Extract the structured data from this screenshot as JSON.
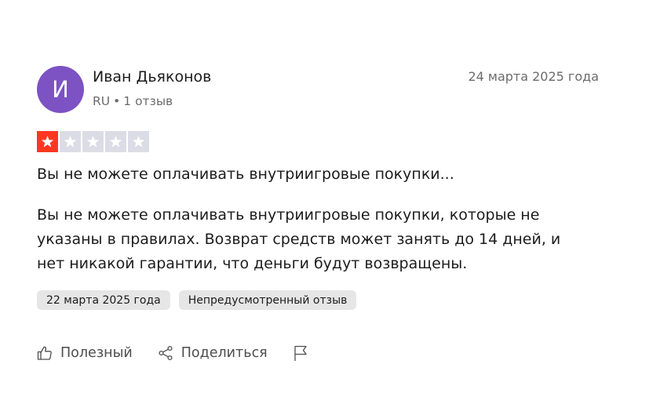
{
  "review": {
    "author": {
      "initial": "И",
      "name": "Иван Дьяконов",
      "country": "RU",
      "separator": "•",
      "review_count": "1 отзыв",
      "avatar_color": "#7d52c3"
    },
    "date": "24 марта 2025 года",
    "rating": 1,
    "rating_max": 5,
    "star_colors": {
      "filled": "#ff3722",
      "empty": "#dcdce6"
    },
    "title": "Вы не можете оплачивать внутриигровые покупки...",
    "body_lines": [
      "Вы не можете оплачивать внутриигровые покупки, которые не",
      "указаны в правилах. Возврат средств может занять до 14 дней, и",
      "нет никакой гарантии, что деньги будут возвращены."
    ],
    "tags": {
      "experience_date": "22 марта 2025 года",
      "unprompted": "Непредусмотренный отзыв"
    },
    "actions": {
      "useful_label": "Полезный",
      "useful_icon": "thumbs-up-icon",
      "share_label": "Поделиться",
      "share_icon": "share-icon",
      "report_icon": "flag-icon"
    }
  }
}
